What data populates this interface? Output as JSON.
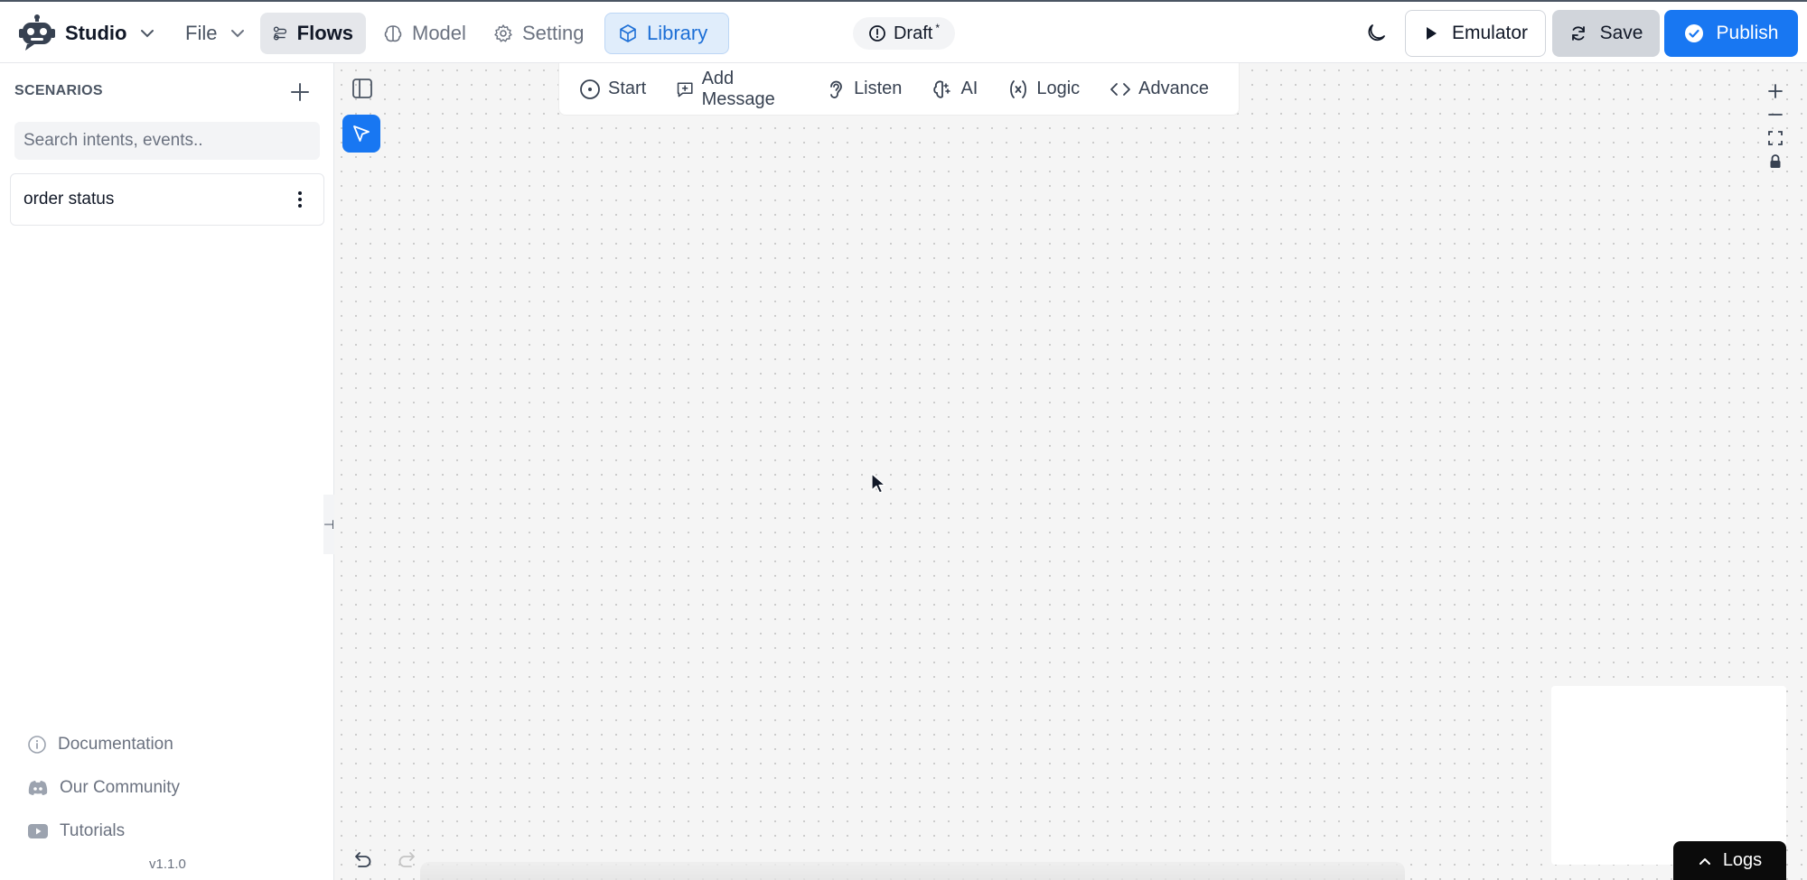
{
  "header": {
    "app_name": "Studio",
    "file_menu": "File",
    "tabs": [
      {
        "label": "Flows",
        "icon": "flows-icon",
        "active": true
      },
      {
        "label": "Model",
        "icon": "brain-icon"
      },
      {
        "label": "Setting",
        "icon": "gear-icon"
      },
      {
        "label": "Library",
        "icon": "cube-icon",
        "highlighted": true
      }
    ],
    "status_label": "Draft",
    "status_marker": "*",
    "emulator_label": "Emulator",
    "save_label": "Save",
    "publish_label": "Publish"
  },
  "sidebar": {
    "title": "SCENARIOS",
    "search_placeholder": "Search intents, events..",
    "scenarios": [
      {
        "label": "order status"
      }
    ],
    "footer_links": [
      {
        "label": "Documentation",
        "icon": "info-icon"
      },
      {
        "label": "Our Community",
        "icon": "discord-icon"
      },
      {
        "label": "Tutorials",
        "icon": "youtube-icon"
      }
    ],
    "version": "v1.1.0"
  },
  "toolbar": {
    "tools": [
      {
        "label": "Start",
        "icon": "start-icon"
      },
      {
        "label": "Add Message",
        "icon": "message-plus-icon"
      },
      {
        "label": "Listen",
        "icon": "ear-icon"
      },
      {
        "label": "AI",
        "icon": "ai-brain-icon"
      },
      {
        "label": "Logic",
        "icon": "variable-icon"
      },
      {
        "label": "Advance",
        "icon": "code-icon"
      }
    ]
  },
  "canvas": {
    "logs_label": "Logs"
  },
  "colors": {
    "accent": "#1877f2",
    "library_tab_bg": "#e0edfb",
    "canvas_bg": "#f5f5f5",
    "logs_bg": "#0b0b0b"
  }
}
